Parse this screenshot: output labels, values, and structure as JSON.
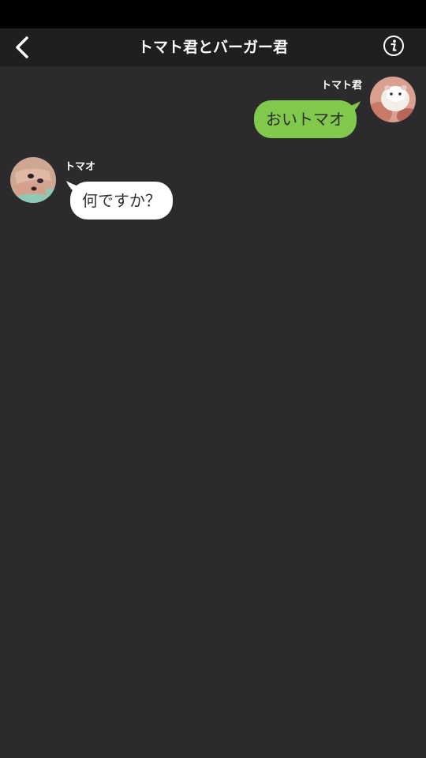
{
  "header": {
    "title": "トマト君とバーガー君",
    "back_icon": "chevron-left-icon",
    "info_icon": "info-icon"
  },
  "colors": {
    "background": "#2b2a2c",
    "header_bg": "#1f1f1f",
    "outgoing_bubble": "#81c94c",
    "incoming_bubble": "#ffffff"
  },
  "messages": [
    {
      "direction": "outgoing",
      "sender": "トマト君",
      "text": "おいトマオ",
      "avatar_icon": "hamster-avatar-icon"
    },
    {
      "direction": "incoming",
      "sender": "トマオ",
      "text": "何ですか？",
      "avatar_icon": "hand-photo-avatar-icon"
    }
  ]
}
